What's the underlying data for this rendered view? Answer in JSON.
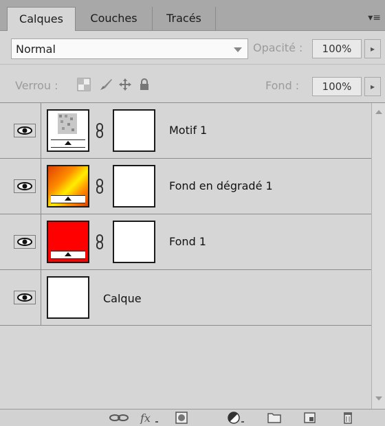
{
  "tabs": [
    {
      "label": "Calques",
      "active": true
    },
    {
      "label": "Couches",
      "active": false
    },
    {
      "label": "Tracés",
      "active": false
    }
  ],
  "panel_menu_icon": "panel-menu-icon",
  "blend_mode": {
    "value": "Normal"
  },
  "opacity": {
    "label": "Opacité :",
    "value": "100%"
  },
  "lock": {
    "label": "Verrou :",
    "icons": [
      "lock-transparent-pixels-icon",
      "lock-image-pixels-icon",
      "lock-position-icon",
      "lock-all-icon"
    ]
  },
  "fill": {
    "label": "Fond :",
    "value": "100%"
  },
  "layers": [
    {
      "name": "Motif 1",
      "thumb": "pattern",
      "has_mask": true,
      "visible": true
    },
    {
      "name": "Fond en dégradé 1",
      "thumb": "gradient",
      "has_mask": true,
      "visible": true,
      "colors": [
        "#ff6a00",
        "#ffee00"
      ]
    },
    {
      "name": "Fond 1",
      "thumb": "solid",
      "has_mask": true,
      "visible": true,
      "colors": [
        "#ff0000"
      ]
    },
    {
      "name": "Calque",
      "thumb": "blank",
      "has_mask": false,
      "visible": true
    }
  ],
  "toolbar_icons": [
    "link-layers-icon",
    "fx-icon",
    "add-mask-icon",
    "adjustment-layer-icon",
    "new-group-icon",
    "new-layer-icon",
    "trash-icon"
  ]
}
